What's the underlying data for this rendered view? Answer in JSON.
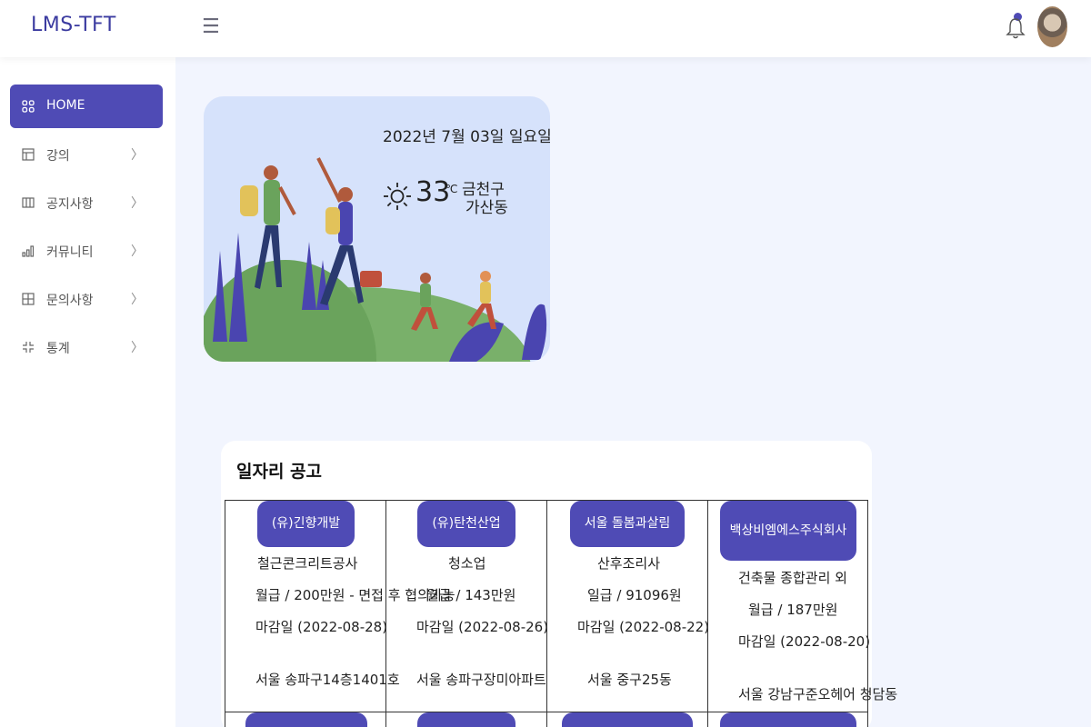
{
  "header": {
    "brand": "LMS-TFT",
    "menu_icon": "hamburger-icon",
    "bell_icon": "bell-icon",
    "avatar_icon": "avatar"
  },
  "sidebar": {
    "items": [
      {
        "label": "HOME",
        "icon": "grid-icon",
        "active": true
      },
      {
        "label": "강의",
        "icon": "layout-icon"
      },
      {
        "label": "공지사항",
        "icon": "columns-icon"
      },
      {
        "label": "커뮤니티",
        "icon": "bar-chart-icon"
      },
      {
        "label": "문의사항",
        "icon": "box-grid-icon"
      },
      {
        "label": "통계",
        "icon": "minimize-icon"
      }
    ]
  },
  "weather": {
    "date": "2022년 7월 03일 일요일",
    "temperature": "33",
    "unit": "℃",
    "location_line1": "금천구",
    "location_line2": "가산동",
    "icon": "sun-icon"
  },
  "jobs": {
    "title": "일자리 공고",
    "postings": [
      {
        "company": "(유)긴향개발",
        "role": "철근콘크리트공사",
        "pay": "월급 / 200만원 - 면접 후 협의가능",
        "deadline": "마감일 (2022-08-28)",
        "address": "서울 송파구14층1401호"
      },
      {
        "company": "(유)탄천산업",
        "role": "청소업",
        "pay": "월급 / 143만원",
        "deadline": "마감일 (2022-08-26)",
        "address": "서울 송파구장미아파트"
      },
      {
        "company": "서울 돌봄과살림",
        "role": "산후조리사",
        "pay": "일급 / 91096원",
        "deadline": "마감일 (2022-08-22)",
        "address": "서울 중구25동"
      },
      {
        "company": "백상비엠에스주식회사",
        "role": "건축물 종합관리 외",
        "pay": "월급 / 187만원",
        "deadline": "마감일 (2022-08-20)",
        "address": "서울 강남구준오헤어 청담동"
      }
    ]
  }
}
